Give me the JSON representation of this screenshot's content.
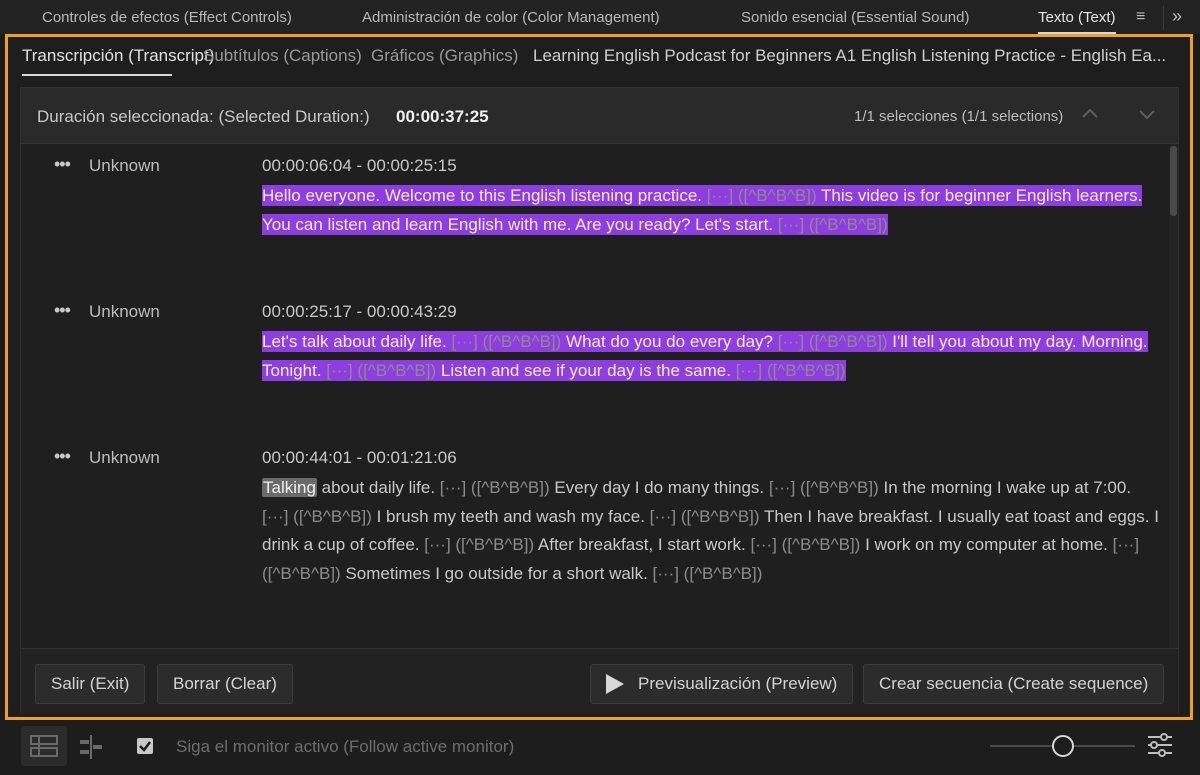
{
  "top_tabs": [
    {
      "label": "Controles de efectos (Effect Controls)",
      "active": false
    },
    {
      "label": "Administración de color (Color Management)",
      "active": false
    },
    {
      "label": "Sonido esencial (Essential Sound)",
      "active": false
    },
    {
      "label": "Texto (Text)",
      "active": true
    }
  ],
  "top_icons": {
    "menu": "hamburger-menu-icon",
    "overflow": "chevron-double-right-icon"
  },
  "panel": {
    "tabs": [
      {
        "label": "Transcripción (Transcript)",
        "active": true
      },
      {
        "label": "Subtítulos (Captions)",
        "active": false
      },
      {
        "label": "Gráficos (Graphics)",
        "active": false
      }
    ],
    "sequence_title": "Learning English Podcast for Beginners A1 English Listening Practice - English Ea...",
    "accent_border": "#f0a122"
  },
  "selection": {
    "label": "Duración seleccionada: (Selected Duration:)",
    "value": "00:00:37:25",
    "count": "1/1 selecciones (1/1 selections)"
  },
  "highlight_color": "#8e3ee0",
  "segments": [
    {
      "speaker": "Unknown",
      "time": "00:00:06:04 - 00:00:25:15",
      "parts": [
        {
          "t": "Hello everyone. Welcome to this English listening practice. ",
          "hl": true
        },
        {
          "t": "[···] ([^B^B^B])",
          "hl": true,
          "dim": true
        },
        {
          "t": " This video is for beginner English learners. You can listen and learn English with me. Are you ready? Let's start. ",
          "hl": true
        },
        {
          "t": "[···] ([^B^B^B])",
          "hl": true,
          "dim": true
        }
      ]
    },
    {
      "speaker": "Unknown",
      "time": "00:00:25:17 - 00:00:43:29",
      "parts": [
        {
          "t": "Let's talk about daily life. ",
          "hl": true
        },
        {
          "t": "[···] ([^B^B^B])",
          "hl": true,
          "dim": true
        },
        {
          "t": " What do you do every day? ",
          "hl": true
        },
        {
          "t": "[···] ([^B^B^B])",
          "hl": true,
          "dim": true
        },
        {
          "t": " I'll tell you about my day. Morning. Tonight. ",
          "hl": true
        },
        {
          "t": "[···] ([^B^B^B])",
          "hl": true,
          "dim": true
        },
        {
          "t": " Listen and see if your day is the same. ",
          "hl": true
        },
        {
          "t": "[···] ([^B^B^B])",
          "hl": true,
          "dim": true
        }
      ]
    },
    {
      "speaker": "Unknown",
      "time": "00:00:44:01 - 00:01:21:06",
      "parts": [
        {
          "t": "Talking",
          "chip": true
        },
        {
          "t": " about daily life. "
        },
        {
          "t": "[···] ([^B^B^B])",
          "dim": true
        },
        {
          "t": " Every day I do many things. "
        },
        {
          "t": "[···] ([^B^B^B])",
          "dim": true
        },
        {
          "t": " In the morning I wake up at 7:00. "
        },
        {
          "t": "[···] ([^B^B^B])",
          "dim": true
        },
        {
          "t": " I brush my teeth and wash my face. "
        },
        {
          "t": "[···] ([^B^B^B])",
          "dim": true
        },
        {
          "t": " Then I have breakfast. I usually eat toast and eggs. I drink a cup of coffee. "
        },
        {
          "t": "[···] ([^B^B^B])",
          "dim": true
        },
        {
          "t": " After breakfast, I start work. "
        },
        {
          "t": "[···] ([^B^B^B])",
          "dim": true
        },
        {
          "t": " I work on my computer at home. "
        },
        {
          "t": "[···] ([^B^B^B])",
          "dim": true
        },
        {
          "t": " Sometimes I go outside for a short walk. "
        },
        {
          "t": "[···] ([^B^B^B])",
          "dim": true
        }
      ]
    }
  ],
  "buttons": {
    "exit": "Salir (Exit)",
    "clear": "Borrar (Clear)",
    "preview": "Previsualización (Preview)",
    "create_sequence": "Crear secuencia (Create sequence)"
  },
  "footer": {
    "follow_label": "Siga el monitor activo (Follow active monitor)",
    "follow_checked": true,
    "zoom_level": 0.45
  }
}
